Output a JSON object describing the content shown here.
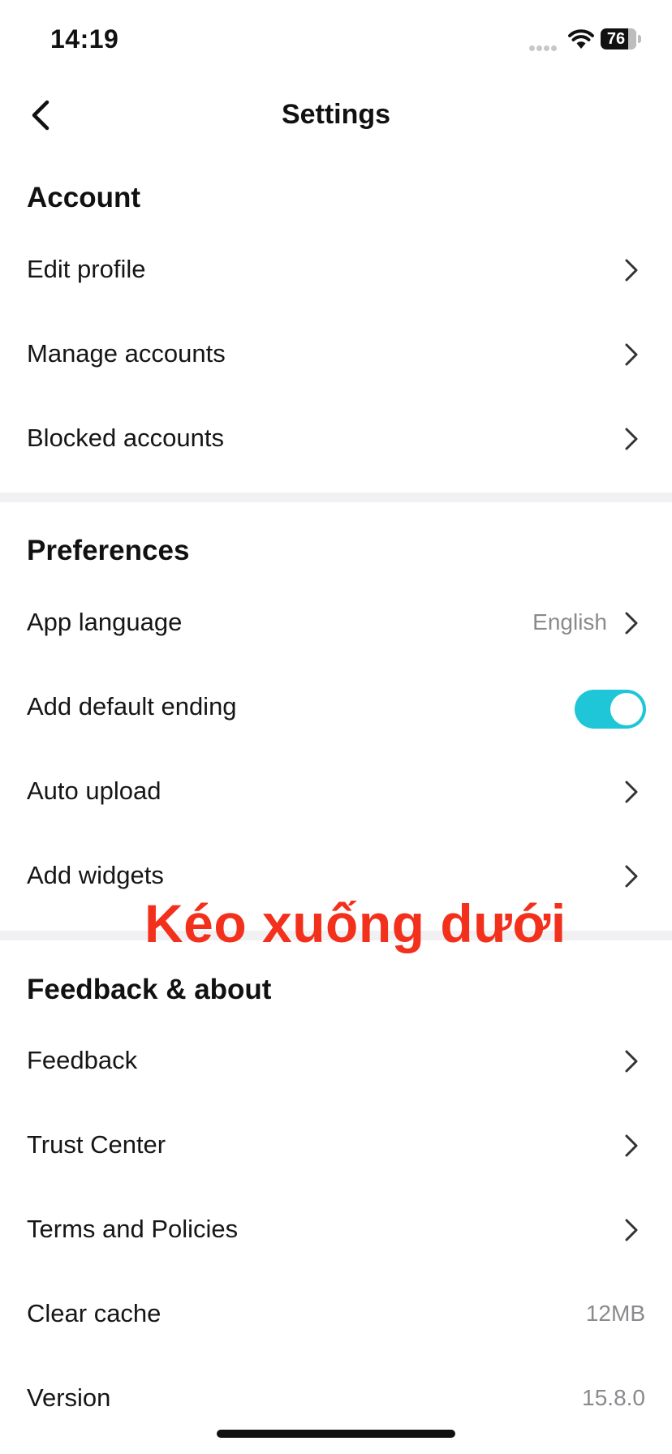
{
  "status_bar": {
    "time": "14:19",
    "battery": "76",
    "icons": [
      "cellular-signal-icon",
      "wifi-icon",
      "battery-icon"
    ]
  },
  "header": {
    "title": "Settings",
    "back_icon": "chevron-left-icon"
  },
  "sections": {
    "account": {
      "title": "Account",
      "items": [
        {
          "label": "Edit profile"
        },
        {
          "label": "Manage accounts"
        },
        {
          "label": "Blocked accounts"
        }
      ]
    },
    "preferences": {
      "title": "Preferences",
      "items": [
        {
          "label": "App language",
          "value": "English"
        },
        {
          "label": "Add default ending",
          "toggle": true
        },
        {
          "label": "Auto upload"
        },
        {
          "label": "Add widgets"
        }
      ]
    },
    "feedback": {
      "title": "Feedback & about",
      "items": [
        {
          "label": "Feedback"
        },
        {
          "label": "Trust Center"
        },
        {
          "label": "Terms and Policies"
        },
        {
          "label": "Clear cache",
          "value": "12MB"
        },
        {
          "label": "Version",
          "value": "15.8.0"
        }
      ]
    }
  },
  "overlay": {
    "caption": "Kéo xuống dưới"
  },
  "colors": {
    "toggle_on": "#1ec6d8",
    "overlay_text": "#f2301c",
    "secondary_text": "#8a8a8e",
    "section_band": "#f1f1f3"
  }
}
